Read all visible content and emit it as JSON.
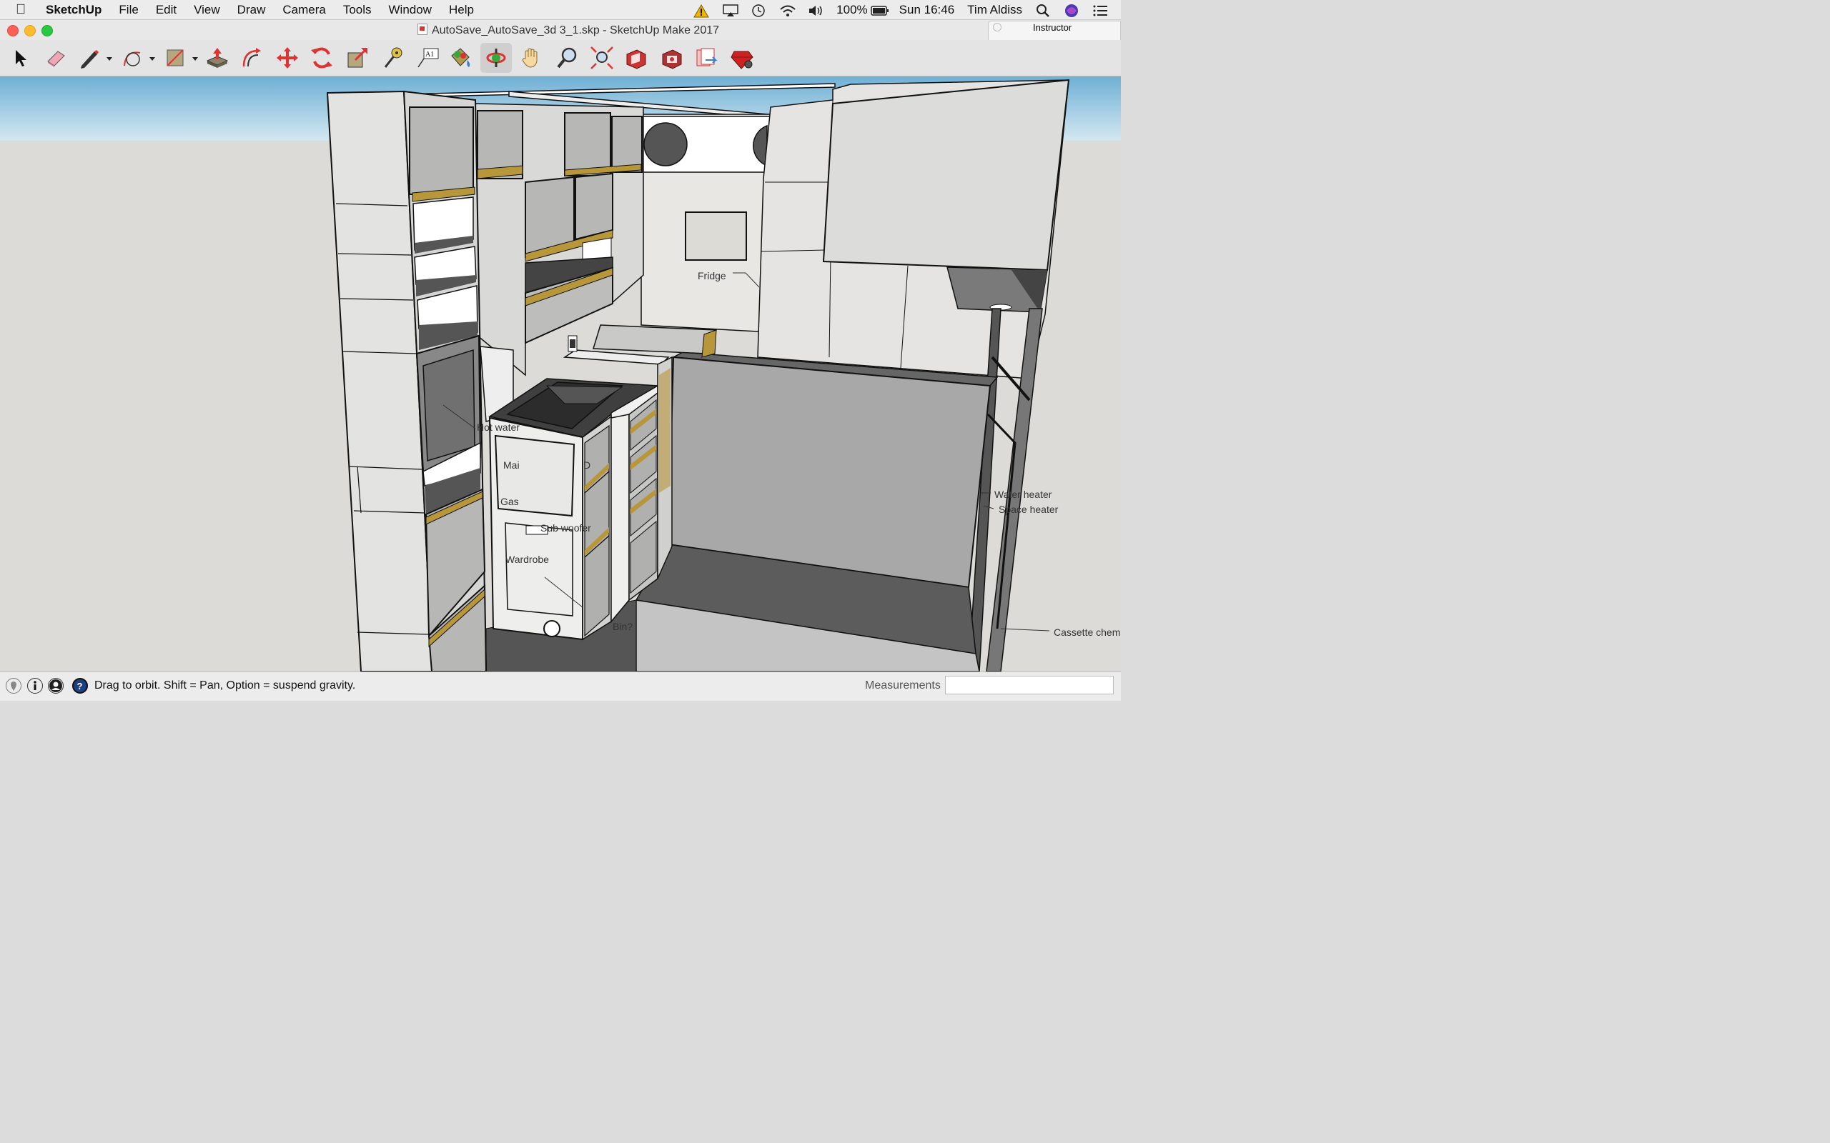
{
  "menubar": {
    "app_name": "SketchUp",
    "items": [
      "File",
      "Edit",
      "View",
      "Draw",
      "Camera",
      "Tools",
      "Window",
      "Help"
    ],
    "battery": "100%",
    "clock": "Sun 16:46",
    "user": "Tim Aldiss"
  },
  "window": {
    "title": "AutoSave_AutoSave_3d 3_1.skp - SketchUp Make 2017",
    "instructor_label": "Instructor"
  },
  "toolbar": {
    "tools": [
      "select-tool",
      "eraser-tool",
      "pencil-tool",
      "arc-tool",
      "shapes-tool",
      "push-pull-tool",
      "offset-tool",
      "move-tool",
      "rotate-tool",
      "scale-tool",
      "tape-measure-tool",
      "text-tool",
      "paint-bucket-tool",
      "orbit-tool",
      "pan-tool",
      "zoom-tool",
      "zoom-extents-tool",
      "3d-warehouse-tool",
      "extension-warehouse-tool",
      "layout-tool",
      "send-to-layout-tool",
      "ruby-console-tool"
    ],
    "active_tool": "orbit-tool",
    "text_tool_glyph": "A1"
  },
  "model_labels": {
    "fridge": "Fridge",
    "hot_water": "Hot water",
    "main": "Mai",
    "gas": "Gas",
    "sub_woofer": "Sub woofer",
    "d_label": "D",
    "wardrobe": "Wardrobe",
    "bin": "Bin?",
    "water_heater": "Water heater",
    "space_heater": "Space heater",
    "cassette": "Cassette chem"
  },
  "statusbar": {
    "hint": "Drag to orbit. Shift = Pan, Option = suspend gravity.",
    "measurements_label": "Measurements",
    "measurements_value": ""
  }
}
